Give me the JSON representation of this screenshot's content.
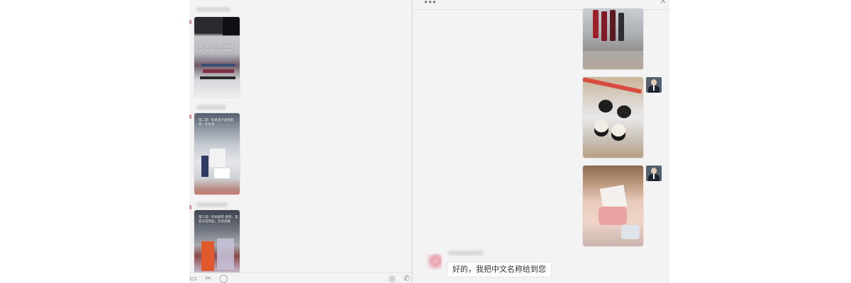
{
  "right_chat": {
    "title": "...",
    "close_glyph": "×",
    "reply_message": "好的，我把中文名称给到您"
  },
  "left_chat": {
    "captions": [
      "第一袋：口红类，彩妆类等，会包括对不同颜色的",
      "第二袋：粉系盘子类别套装、彩妆类",
      "第三袋：彩妆套装-套装，美容日常用品，包括润肤"
    ]
  },
  "icons": {
    "folder": "folder-icon",
    "scissors": "scissors-icon",
    "chat_bubble": "chat-bubble-icon",
    "screen_share": "screen-share-icon",
    "phone": "phone-icon"
  },
  "colors": {
    "pane_background": "#f3f3f3",
    "bubble_background": "#ffffff",
    "text": "#333333"
  }
}
